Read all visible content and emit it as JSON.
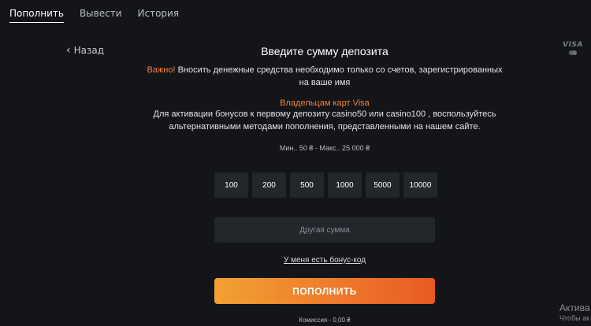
{
  "tabs": [
    {
      "label": "Пополнить",
      "active": true
    },
    {
      "label": "Вывести",
      "active": false
    },
    {
      "label": "История",
      "active": false
    }
  ],
  "back": {
    "label": "Назад",
    "icon": "chevron-left-icon"
  },
  "payment_logo": {
    "text": "VISA",
    "icon": "mastercard-icon"
  },
  "deposit": {
    "title": "Введите сумму депозита",
    "warning_label": "Важно!",
    "warning_text": " Вносить денежные средства необходимо только со счетов, зарегистрированных на ваше имя",
    "visa_title": "Владельцам карт Visa",
    "visa_text": "Для активации бонусов к первому депозиту casino50 или casino100 , воспользуйтесь альтернативными методами пополнения, представленными на нашем сайте.",
    "limits": "Мин.. 50 ₴ - Макс.. 25 000 ₴",
    "amounts": [
      "100",
      "200",
      "500",
      "1000",
      "5000",
      "10000"
    ],
    "custom_placeholder": "Другая сумма",
    "bonus_link": "У меня есть бонус-код",
    "submit_label": "ПОПОЛНИТЬ",
    "commission": "Комиссия - 0,00 ₴"
  },
  "watermark": {
    "line1": "Актива",
    "line2": "Чтобы ак"
  },
  "colors": {
    "accent": "#f0813a",
    "background": "#141518",
    "tile": "#23262b"
  }
}
